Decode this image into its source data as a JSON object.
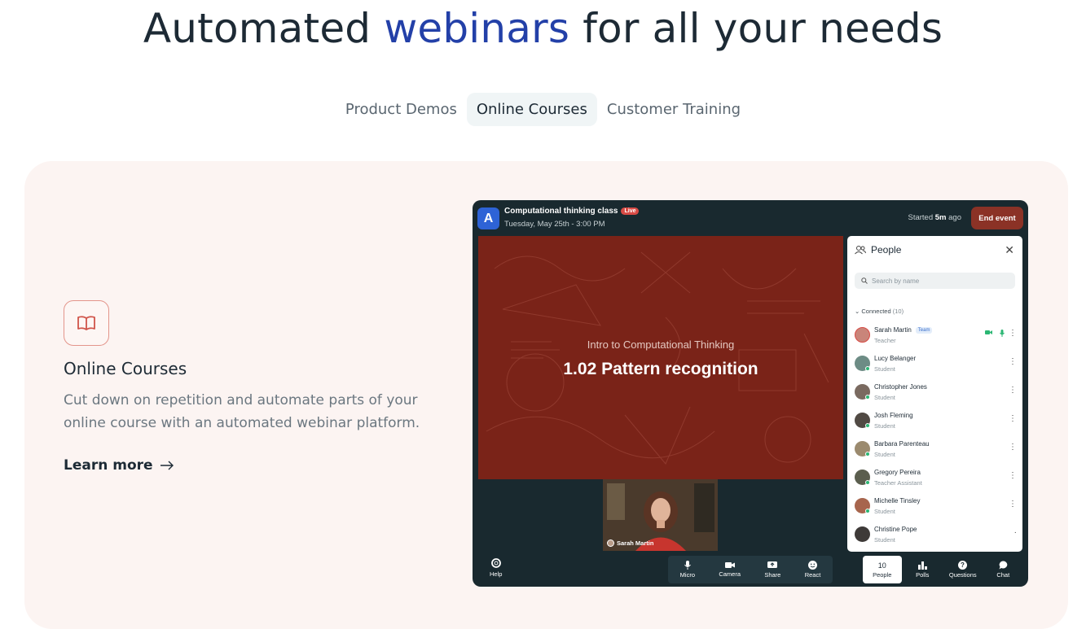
{
  "headline": {
    "before": "Automated ",
    "accent": "webinars",
    "after": " for all your needs"
  },
  "tabs": [
    {
      "label": "Product Demos"
    },
    {
      "label": "Online Courses"
    },
    {
      "label": "Customer Training"
    }
  ],
  "feature": {
    "icon": "book-icon",
    "title": "Online Courses",
    "description": "Cut down on repetition and automate parts of your online course with an automated webinar platform.",
    "link_label": "Learn more"
  },
  "app": {
    "logo_letter": "A",
    "event_title": "Computational thinking class",
    "live_label": "Live",
    "event_date": "Tuesday, May 25th - 3:00 PM",
    "started_prefix": "Started ",
    "started_value": "5m",
    "started_suffix": " ago",
    "end_button": "End event",
    "slide": {
      "subtitle": "Intro to Computational Thinking",
      "title": "1.02 Pattern recognition"
    },
    "presenter_name": "Sarah Martin",
    "people_panel": {
      "title": "People",
      "search_placeholder": "Search by name",
      "section_label": "Connected",
      "section_count": "(10)",
      "people": [
        {
          "name": "Sarah Martin",
          "role": "Teacher",
          "tag": "Team"
        },
        {
          "name": "Lucy Belanger",
          "role": "Student"
        },
        {
          "name": "Christopher Jones",
          "role": "Student"
        },
        {
          "name": "Josh Fleming",
          "role": "Student"
        },
        {
          "name": "Barbara Parenteau",
          "role": "Student"
        },
        {
          "name": "Gregory Pereira",
          "role": "Teacher Assistant"
        },
        {
          "name": "Michelle Tinsley",
          "role": "Student"
        },
        {
          "name": "Christine Pope",
          "role": "Student"
        }
      ]
    },
    "help_label": "Help",
    "controls": [
      {
        "label": "Micro"
      },
      {
        "label": "Camera"
      },
      {
        "label": "Share"
      },
      {
        "label": "React"
      }
    ],
    "right_controls": {
      "people_count": "10",
      "people": "People",
      "polls": "Polls",
      "questions": "Questions",
      "chat": "Chat"
    }
  },
  "colors": {
    "accent": "#2340a8",
    "card_bg": "#fcf4f2",
    "slide_bg": "#7a2318",
    "app_bg": "#19292f",
    "end_btn": "#8b3226"
  }
}
